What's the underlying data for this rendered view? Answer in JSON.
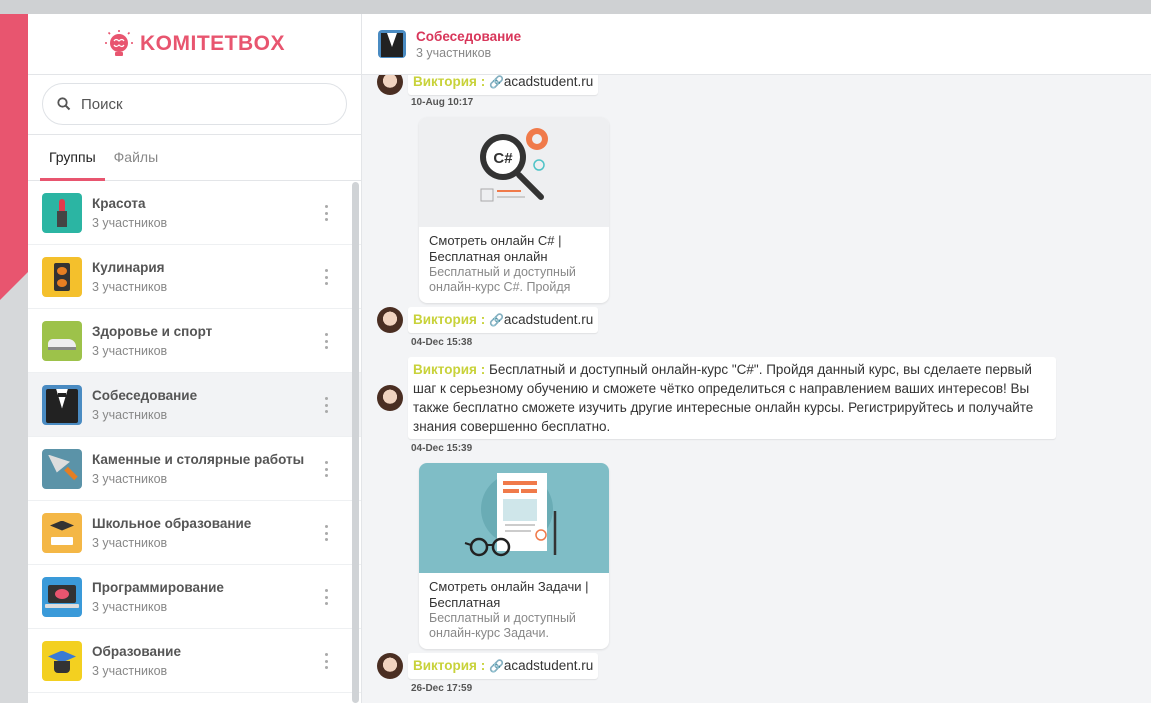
{
  "brand": {
    "logo_text": "KOMITETBOX",
    "accent": "#e8556f"
  },
  "search": {
    "placeholder": "Поиск"
  },
  "tabs": [
    {
      "label": "Группы",
      "active": true
    },
    {
      "label": "Файлы",
      "active": false
    }
  ],
  "groups": [
    {
      "name": "Красота",
      "members": "3 участников",
      "icon": "lipstick-icon"
    },
    {
      "name": "Кулинария",
      "members": "3 участников",
      "icon": "stove-icon"
    },
    {
      "name": "Здоровье и спорт",
      "members": "3 участников",
      "icon": "sneaker-icon"
    },
    {
      "name": "Собеседование",
      "members": "3 участников",
      "icon": "tuxedo-icon",
      "active": true
    },
    {
      "name": "Каменные и столярные работы",
      "members": "3 участников",
      "icon": "trowel-icon"
    },
    {
      "name": "Школьное образование",
      "members": "3 участников",
      "icon": "graduation-cap-icon"
    },
    {
      "name": "Программирование",
      "members": "3 участников",
      "icon": "laptop-icon"
    },
    {
      "name": "Образование",
      "members": "3 участников",
      "icon": "mortarboard-icon"
    }
  ],
  "chat": {
    "title": "Собеседование",
    "members": "3 участников",
    "messages": [
      {
        "sender": "Виктория",
        "sep": ":",
        "text": "acadstudent.ru",
        "time": "10-Aug 10:17"
      },
      {
        "card_title": "Смотреть онлайн C# | Бесплатная онлайн",
        "card_desc": "Бесплатный и доступный онлайн-курс C#. Пройдя"
      },
      {
        "sender": "Виктория",
        "sep": ":",
        "text": "acadstudent.ru",
        "time": "04-Dec 15:38"
      },
      {
        "sender": "Виктория",
        "sep": ":",
        "text": "Бесплатный и доступный онлайн-курс \"C#\". Пройдя данный курс, вы сделаете первый шаг к серьезному обучению и сможете чётко определиться с направлением ваших интересов! Вы также бесплатно сможете изучить другие интересные онлайн курсы. Регистрируйтесь и получайте знания совершенно бесплатно.",
        "time": "04-Dec 15:39"
      },
      {
        "card_title": "Смотреть онлайн Задачи | Бесплатная",
        "card_desc": "Бесплатный и доступный онлайн-курс Задачи."
      },
      {
        "sender": "Виктория",
        "sep": ":",
        "text": "acadstudent.ru",
        "time": "26-Dec 17:59"
      }
    ]
  }
}
